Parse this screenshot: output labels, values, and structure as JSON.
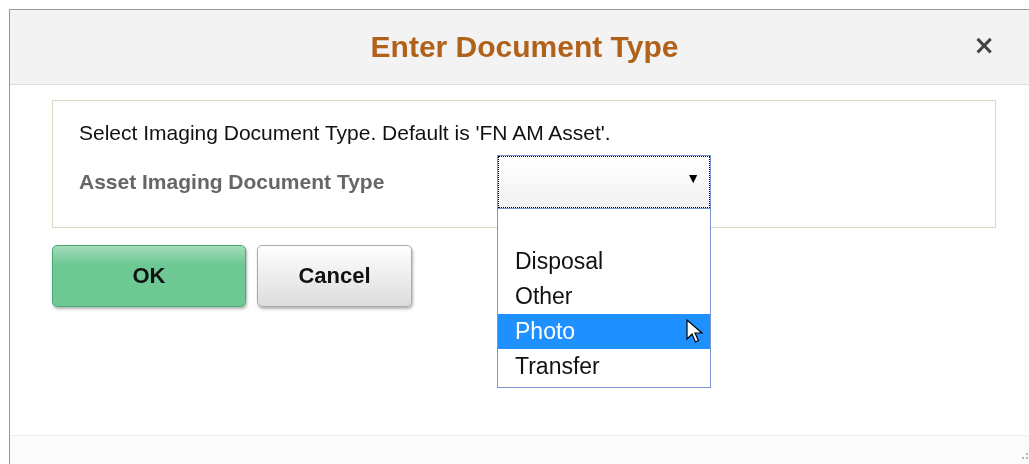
{
  "dialog": {
    "title": "Enter Document Type",
    "close": "×"
  },
  "instructions": "Select Imaging Document Type. Default is 'FN AM Asset'.",
  "field": {
    "label": "Asset Imaging Document Type",
    "arrow": "▼",
    "expanded": true,
    "options": [
      {
        "label": "Disposal",
        "selected": false
      },
      {
        "label": "Other",
        "selected": false
      },
      {
        "label": "Photo",
        "selected": true
      },
      {
        "label": "Transfer",
        "selected": false
      }
    ]
  },
  "buttons": [
    {
      "label": "OK",
      "kind": "primary"
    },
    {
      "label": "Cancel",
      "kind": "secondary"
    }
  ]
}
